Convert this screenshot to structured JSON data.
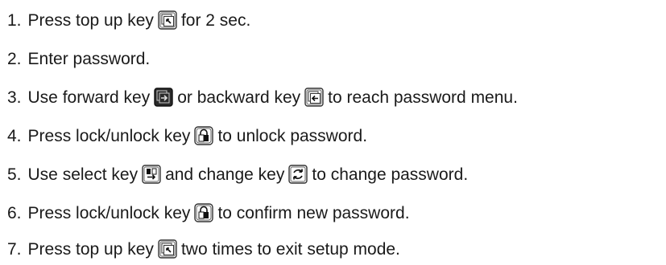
{
  "steps": [
    {
      "number": "1.",
      "parts": [
        {
          "text": "Press top up key"
        },
        {
          "icon": "top-up-key-icon"
        },
        {
          "text": "for 2 sec."
        }
      ]
    },
    {
      "number": "2.",
      "parts": [
        {
          "text": "Enter password."
        }
      ]
    },
    {
      "number": "3.",
      "parts": [
        {
          "text": "Use forward key"
        },
        {
          "icon": "forward-key-icon"
        },
        {
          "text": "or backward key"
        },
        {
          "icon": "backward-key-icon"
        },
        {
          "text": "to reach password menu."
        }
      ]
    },
    {
      "number": "4.",
      "parts": [
        {
          "text": "Press lock/unlock key"
        },
        {
          "icon": "lock-unlock-key-icon"
        },
        {
          "text": "to unlock password."
        }
      ]
    },
    {
      "number": "5.",
      "parts": [
        {
          "text": "Use select key"
        },
        {
          "icon": "select-key-icon"
        },
        {
          "text": "and change key"
        },
        {
          "icon": "change-key-icon"
        },
        {
          "text": "to change password."
        }
      ]
    },
    {
      "number": "6.",
      "parts": [
        {
          "text": "Press lock/unlock key"
        },
        {
          "icon": "lock-unlock-key-icon"
        },
        {
          "text": "to confirm new password."
        }
      ]
    },
    {
      "number": "7.",
      "parts": [
        {
          "text": "Press top up key"
        },
        {
          "icon": "top-up-key-icon"
        },
        {
          "text": "two times to exit setup mode."
        }
      ]
    }
  ]
}
